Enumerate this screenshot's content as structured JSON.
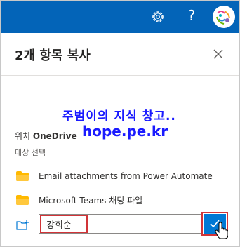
{
  "header": {
    "help_label": "?",
    "settings_icon": "gear-icon",
    "avatar_icon": "user-avatar",
    "accent": "#0364b8"
  },
  "dialog": {
    "title": "2개 항목 복사",
    "close_icon": "close-icon"
  },
  "location": {
    "label": "위치",
    "value": "OneDrive"
  },
  "section_label": "대상 선택",
  "folders": [
    {
      "label": "Email attachments from Power Automate",
      "icon": "folder-icon"
    },
    {
      "label": "Microsoft Teams 채팅 파일",
      "icon": "folder-icon"
    }
  ],
  "new_folder": {
    "icon": "new-folder-icon",
    "value": "강희순",
    "confirm_icon": "checkmark-icon",
    "accent": "#0078d4"
  },
  "watermark": {
    "line1": "주범이의 지식 창고..",
    "line2": "hope.pe.kr"
  },
  "highlight_color": "#d13438"
}
